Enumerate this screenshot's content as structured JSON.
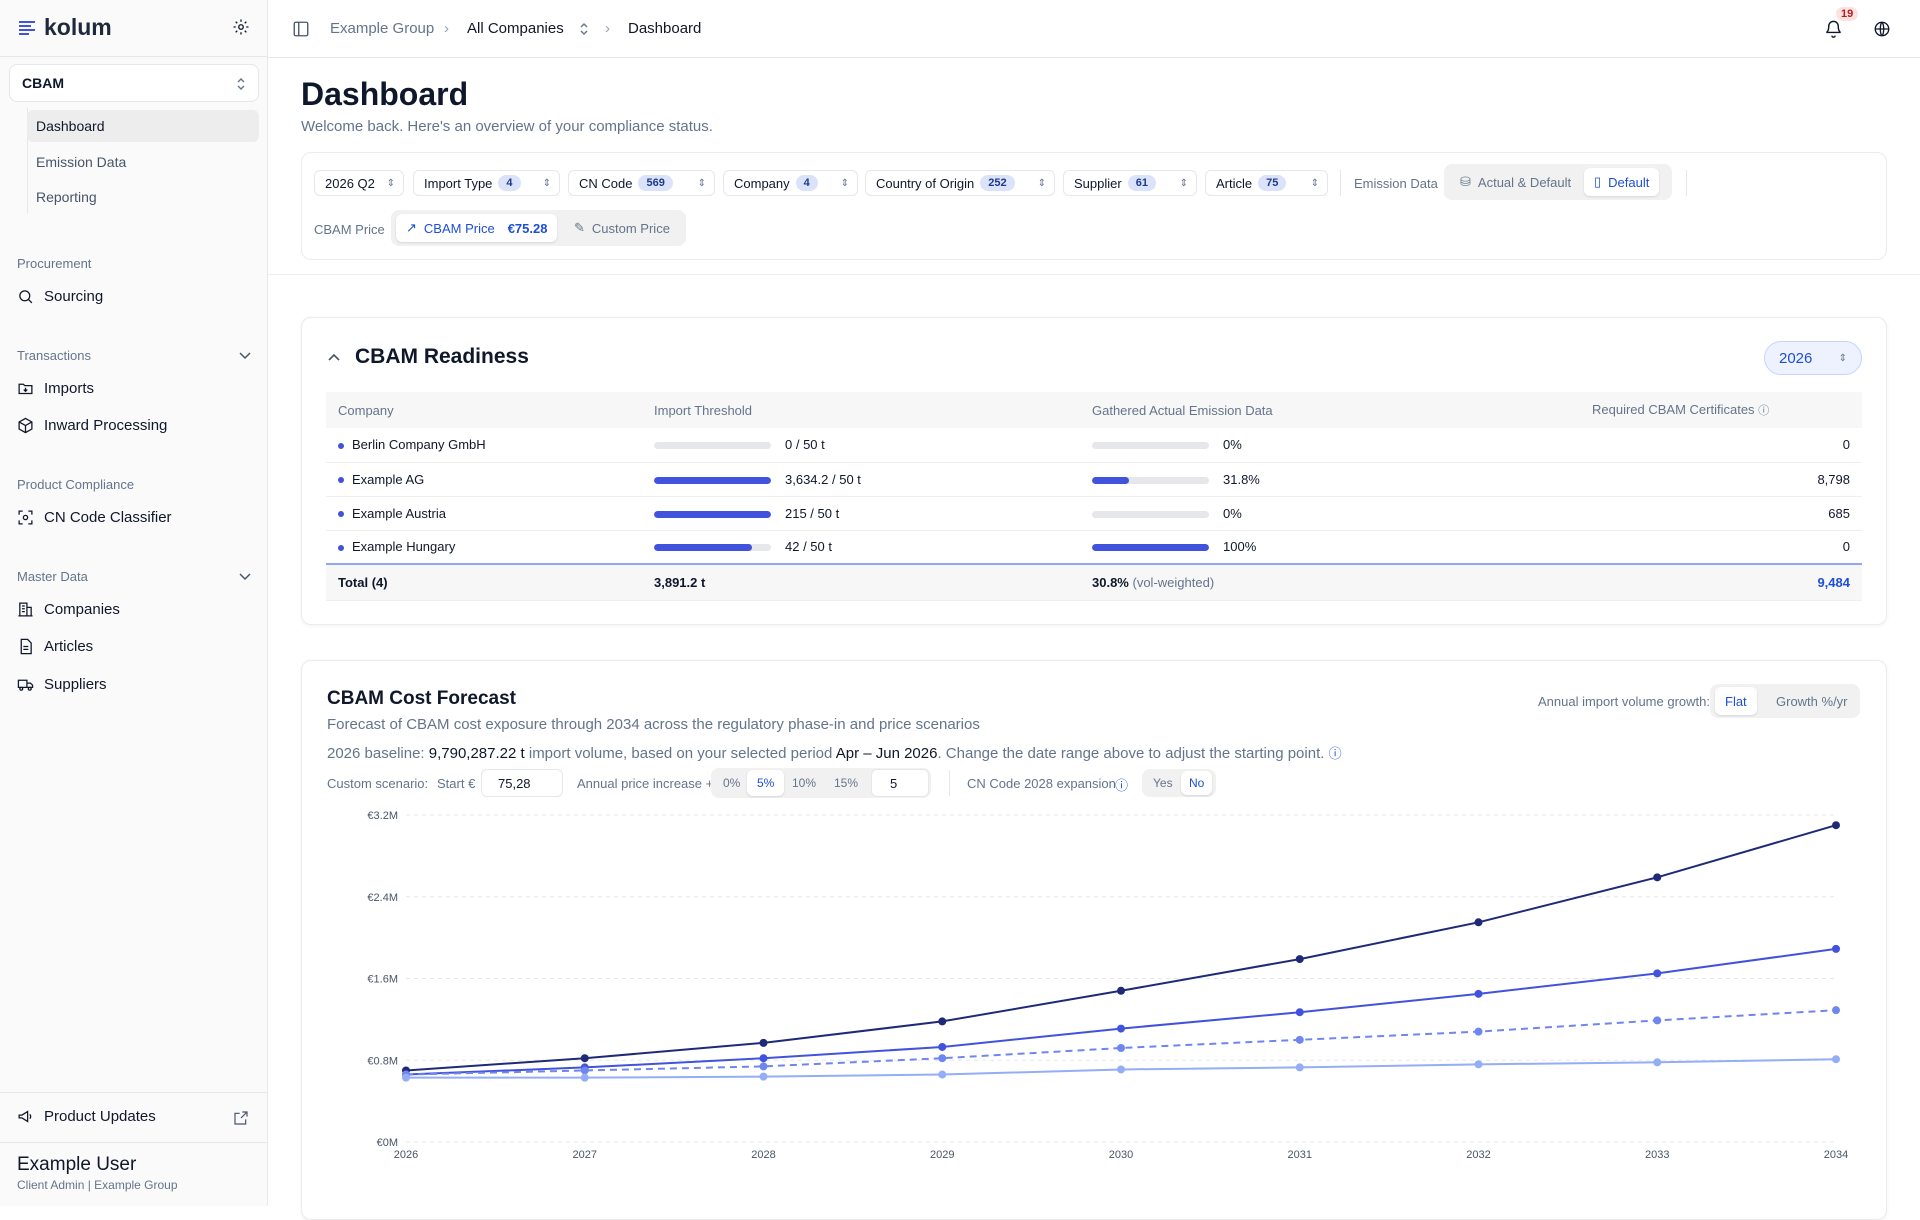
{
  "app": {
    "name": "kolum",
    "module": "CBAM",
    "user_name": "Example User",
    "user_role": "Client Admin | Example Group",
    "notifications": "19"
  },
  "sidebar": {
    "sub_items": [
      "Dashboard",
      "Emission Data",
      "Reporting"
    ],
    "sections": {
      "procurement": "Procurement",
      "transactions": "Transactions",
      "product_compliance": "Product Compliance",
      "master_data": "Master Data"
    },
    "items": {
      "sourcing": "Sourcing",
      "imports": "Imports",
      "inward": "Inward Processing",
      "cn_classifier": "CN Code Classifier",
      "companies": "Companies",
      "articles": "Articles",
      "suppliers": "Suppliers"
    },
    "product_updates": "Product Updates"
  },
  "breadcrumb": {
    "group": "Example Group",
    "companies": "All Companies",
    "page": "Dashboard"
  },
  "page": {
    "title": "Dashboard",
    "subtitle": "Welcome back. Here's an overview of your compliance status."
  },
  "filters": {
    "period": "2026 Q2",
    "import_type": {
      "label": "Import Type",
      "count": "4"
    },
    "cn_code": {
      "label": "CN Code",
      "count": "569"
    },
    "company": {
      "label": "Company",
      "count": "4"
    },
    "country": {
      "label": "Country of Origin",
      "count": "252"
    },
    "supplier": {
      "label": "Supplier",
      "count": "61"
    },
    "article": {
      "label": "Article",
      "count": "75"
    },
    "emission_label": "Emission Data",
    "emission_opt1": "Actual & Default",
    "emission_opt2": "Default",
    "price_label": "CBAM Price",
    "price_opt1": "CBAM Price",
    "price_value": "€75.28",
    "price_opt2": "Custom Price"
  },
  "readiness": {
    "title": "CBAM Readiness",
    "year": "2026",
    "columns": [
      "Company",
      "Import Threshold",
      "Gathered Actual Emission Data",
      "Required CBAM Certificates"
    ],
    "rows": [
      {
        "company": "Berlin Company GmbH",
        "threshold": "0 / 50 t",
        "threshold_pct": 0,
        "emission": "0%",
        "emission_pct": 0,
        "certs": "0"
      },
      {
        "company": "Example AG",
        "threshold": "3,634.2 / 50 t",
        "threshold_pct": 100,
        "emission": "31.8%",
        "emission_pct": 31.8,
        "certs": "8,798"
      },
      {
        "company": "Example Austria",
        "threshold": "215 / 50 t",
        "threshold_pct": 100,
        "emission": "0%",
        "emission_pct": 0,
        "certs": "685"
      },
      {
        "company": "Example Hungary",
        "threshold": "42 / 50 t",
        "threshold_pct": 84,
        "emission": "100%",
        "emission_pct": 100,
        "certs": "0"
      }
    ],
    "total": {
      "label": "Total (4)",
      "threshold": "3,891.2 t",
      "emission": "30.8%",
      "emission_note": "(vol-weighted)",
      "certs": "9,484"
    }
  },
  "forecast": {
    "title": "CBAM Cost Forecast",
    "subtitle": "Forecast of CBAM cost exposure through 2034 across the regulatory phase-in and price scenarios",
    "baseline_pre": "2026 baseline:",
    "baseline_value": "9,790,287.22 t",
    "baseline_mid": "import volume, based on your selected period",
    "baseline_period": "Apr – Jun 2026",
    "baseline_post": ". Change the date range above to adjust the starting point.",
    "growth_label": "Annual import volume growth:",
    "growth_opt1": "Flat",
    "growth_opt2": "Growth %/yr",
    "custom_label": "Custom scenario:",
    "start_label": "Start €",
    "start_value": "75,28",
    "increase_label": "Annual price increase +",
    "inc_opts": [
      "0%",
      "5%",
      "10%",
      "15%"
    ],
    "inc_custom": "5",
    "cn_label": "CN Code 2028 expansion",
    "yes": "Yes",
    "no": "No"
  },
  "chart_data": {
    "type": "line",
    "x": [
      2026,
      2027,
      2028,
      2029,
      2030,
      2031,
      2032,
      2033,
      2034
    ],
    "y_ticks": [
      "€0M",
      "€0.8M",
      "€1.6M",
      "€2.4M",
      "€3.2M"
    ],
    "ylim": [
      0,
      3.2
    ],
    "series": [
      {
        "values": [
          0.7,
          0.82,
          0.97,
          1.18,
          1.48,
          1.79,
          2.15,
          2.59,
          3.1
        ],
        "color": "#1e2a78",
        "dashed": false
      },
      {
        "values": [
          0.66,
          0.73,
          0.82,
          0.93,
          1.11,
          1.27,
          1.45,
          1.65,
          1.89
        ],
        "color": "#4152dc",
        "dashed": false
      },
      {
        "values": [
          0.66,
          0.7,
          0.74,
          0.82,
          0.92,
          1.0,
          1.08,
          1.19,
          1.29
        ],
        "color": "#6f86f0",
        "dashed": true
      },
      {
        "values": [
          0.63,
          0.63,
          0.64,
          0.66,
          0.71,
          0.73,
          0.76,
          0.78,
          0.81
        ],
        "color": "#93adf7",
        "dashed": false
      }
    ]
  }
}
